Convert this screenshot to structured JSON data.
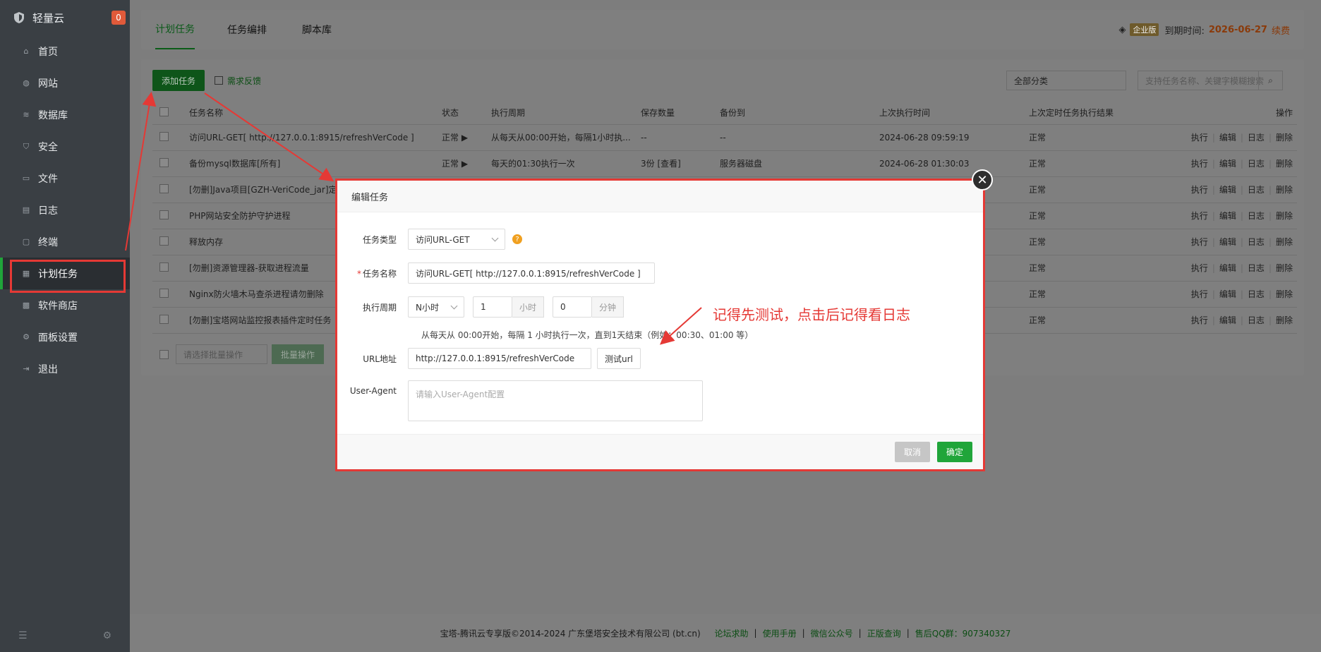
{
  "sidebar": {
    "brand": "轻量云",
    "badge": "0",
    "items": [
      {
        "label": "首页",
        "icon": "home-icon"
      },
      {
        "label": "网站",
        "icon": "globe-icon"
      },
      {
        "label": "数据库",
        "icon": "database-icon"
      },
      {
        "label": "安全",
        "icon": "shield-icon"
      },
      {
        "label": "文件",
        "icon": "folder-icon"
      },
      {
        "label": "日志",
        "icon": "log-icon"
      },
      {
        "label": "终端",
        "icon": "terminal-icon"
      },
      {
        "label": "计划任务",
        "icon": "calendar-icon",
        "active": true
      },
      {
        "label": "软件商店",
        "icon": "grid-icon"
      },
      {
        "label": "面板设置",
        "icon": "gear-icon"
      },
      {
        "label": "退出",
        "icon": "logout-icon"
      }
    ]
  },
  "topbar": {
    "tabs": [
      "计划任务",
      "任务编排",
      "脚本库"
    ],
    "edition": "企业版",
    "expire_label": "到期时间:",
    "expire_date": "2026-06-27",
    "renew": "续费"
  },
  "toolbar": {
    "add_task": "添加任务",
    "feedback": "需求反馈",
    "category": "全部分类",
    "search_placeholder": "支持任务名称、关键字模糊搜索"
  },
  "table": {
    "headers": [
      "任务名称",
      "状态",
      "执行周期",
      "保存数量",
      "备份到",
      "上次执行时间",
      "上次定时任务执行结果",
      "操作"
    ],
    "rows": [
      {
        "name": "访问URL-GET[ http://127.0.0.1:8915/refreshVerCode ]",
        "status": "正常 ▶",
        "cycle": "从每天从00:00开始，每隔1小时执...",
        "keep": "--",
        "backup": "--",
        "last": "2024-06-28 09:59:19",
        "result": "正常"
      },
      {
        "name": "备份mysql数据库[所有]",
        "status": "正常 ▶",
        "cycle": "每天的01:30执行一次",
        "keep": "3份 [查看]",
        "backup": "服务器磁盘",
        "last": "2024-06-28 01:30:03",
        "result": "正常"
      },
      {
        "name": "[勿删]Java项目[GZH-VeriCode_jar]定",
        "status": "",
        "cycle": "",
        "keep": "",
        "backup": "",
        "last": "",
        "result": "正常"
      },
      {
        "name": "PHP网站安全防护守护进程",
        "status": "",
        "cycle": "",
        "keep": "",
        "backup": "",
        "last": "",
        "result": "正常"
      },
      {
        "name": "释放内存",
        "status": "",
        "cycle": "",
        "keep": "",
        "backup": "",
        "last": "",
        "result": "正常"
      },
      {
        "name": "[勿删]资源管理器-获取进程流量",
        "status": "",
        "cycle": "",
        "keep": "",
        "backup": "",
        "last": "",
        "result": "正常"
      },
      {
        "name": "Nginx防火墙木马查杀进程请勿删除",
        "status": "",
        "cycle": "",
        "keep": "",
        "backup": "",
        "last": "",
        "result": "正常"
      },
      {
        "name": "[勿删]宝塔网站监控报表插件定时任务",
        "status": "",
        "cycle": "",
        "keep": "",
        "backup": "",
        "last": "",
        "result": "正常"
      }
    ],
    "ops": [
      "执行",
      "编辑",
      "日志",
      "删除"
    ]
  },
  "bulk": {
    "select": "请选择批量操作",
    "button": "批量操作"
  },
  "modal": {
    "title": "编辑任务",
    "type_label": "任务类型",
    "type_value": "访问URL-GET",
    "name_label": "任务名称",
    "name_value": "访问URL-GET[ http://127.0.0.1:8915/refreshVerCode ]",
    "cycle_label": "执行周期",
    "cycle_unit": "N小时",
    "hours_value": "1",
    "hours_unit": "小时",
    "minutes_value": "0",
    "minutes_unit": "分钟",
    "hint": "从每天从 00:00开始，每隔 1 小时执行一次，直到1天结束（例如：00:30、01:00 等）",
    "url_label": "URL地址",
    "url_value": "http://127.0.0.1:8915/refreshVerCode",
    "test_url": "测试url",
    "ua_label": "User-Agent",
    "ua_placeholder": "请输入User-Agent配置",
    "cancel": "取消",
    "confirm": "确定"
  },
  "annotation": "记得先测试，点击后记得看日志",
  "footer": {
    "copyright": "宝塔-腾讯云专享版©2014-2024 广东堡塔安全技术有限公司 (bt.cn)",
    "links": [
      "论坛求助",
      "使用手册",
      "微信公众号",
      "正版查询",
      "售后QQ群：907340327"
    ]
  }
}
